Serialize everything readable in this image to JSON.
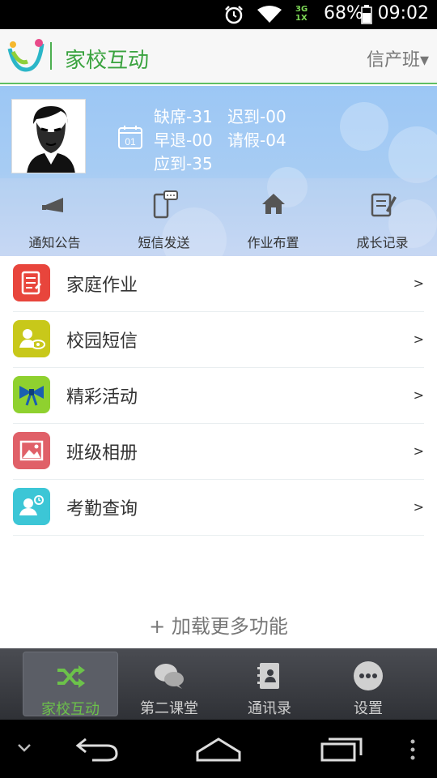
{
  "status_bar": {
    "network_top": "3G",
    "network_bottom": "1X",
    "battery_percent": "68%",
    "time": "09:02"
  },
  "header": {
    "title": "家校互动",
    "class_selector": "信产班▾"
  },
  "attendance": {
    "absent": "缺席-31",
    "late": "迟到-00",
    "left_early": "早退-00",
    "leave": "请假-04",
    "expected": "应到-35",
    "calendar_day": "01"
  },
  "quick_actions": [
    {
      "label": "通知公告",
      "icon": "megaphone-icon"
    },
    {
      "label": "短信发送",
      "icon": "phone-message-icon"
    },
    {
      "label": "作业布置",
      "icon": "home-icon"
    },
    {
      "label": "成长记录",
      "icon": "notebook-pen-icon"
    }
  ],
  "menu": [
    {
      "label": "家庭作业",
      "chevron": ">",
      "icon": "homework-icon",
      "color": "#e8453c"
    },
    {
      "label": "校园短信",
      "chevron": ">",
      "icon": "contact-eye-icon",
      "color": "#c8c81a"
    },
    {
      "label": "精彩活动",
      "chevron": ">",
      "icon": "bow-icon",
      "color": "#8fd12f"
    },
    {
      "label": "班级相册",
      "chevron": ">",
      "icon": "photo-icon",
      "color": "#e06068"
    },
    {
      "label": "考勤查询",
      "chevron": ">",
      "icon": "attendance-icon",
      "color": "#3cc6d6"
    }
  ],
  "load_more": "+ 加载更多功能",
  "tabs": [
    {
      "label": "家校互动",
      "icon": "shuffle-icon",
      "active": true
    },
    {
      "label": "第二课堂",
      "icon": "chat-bubbles-icon",
      "active": false
    },
    {
      "label": "通讯录",
      "icon": "address-book-icon",
      "active": false
    },
    {
      "label": "设置",
      "icon": "more-dots-icon",
      "active": false
    }
  ],
  "colors": {
    "brand_green": "#3aa33f",
    "active_tab_label": "#6cc24a",
    "banner_blue": "#9cc7f5"
  }
}
